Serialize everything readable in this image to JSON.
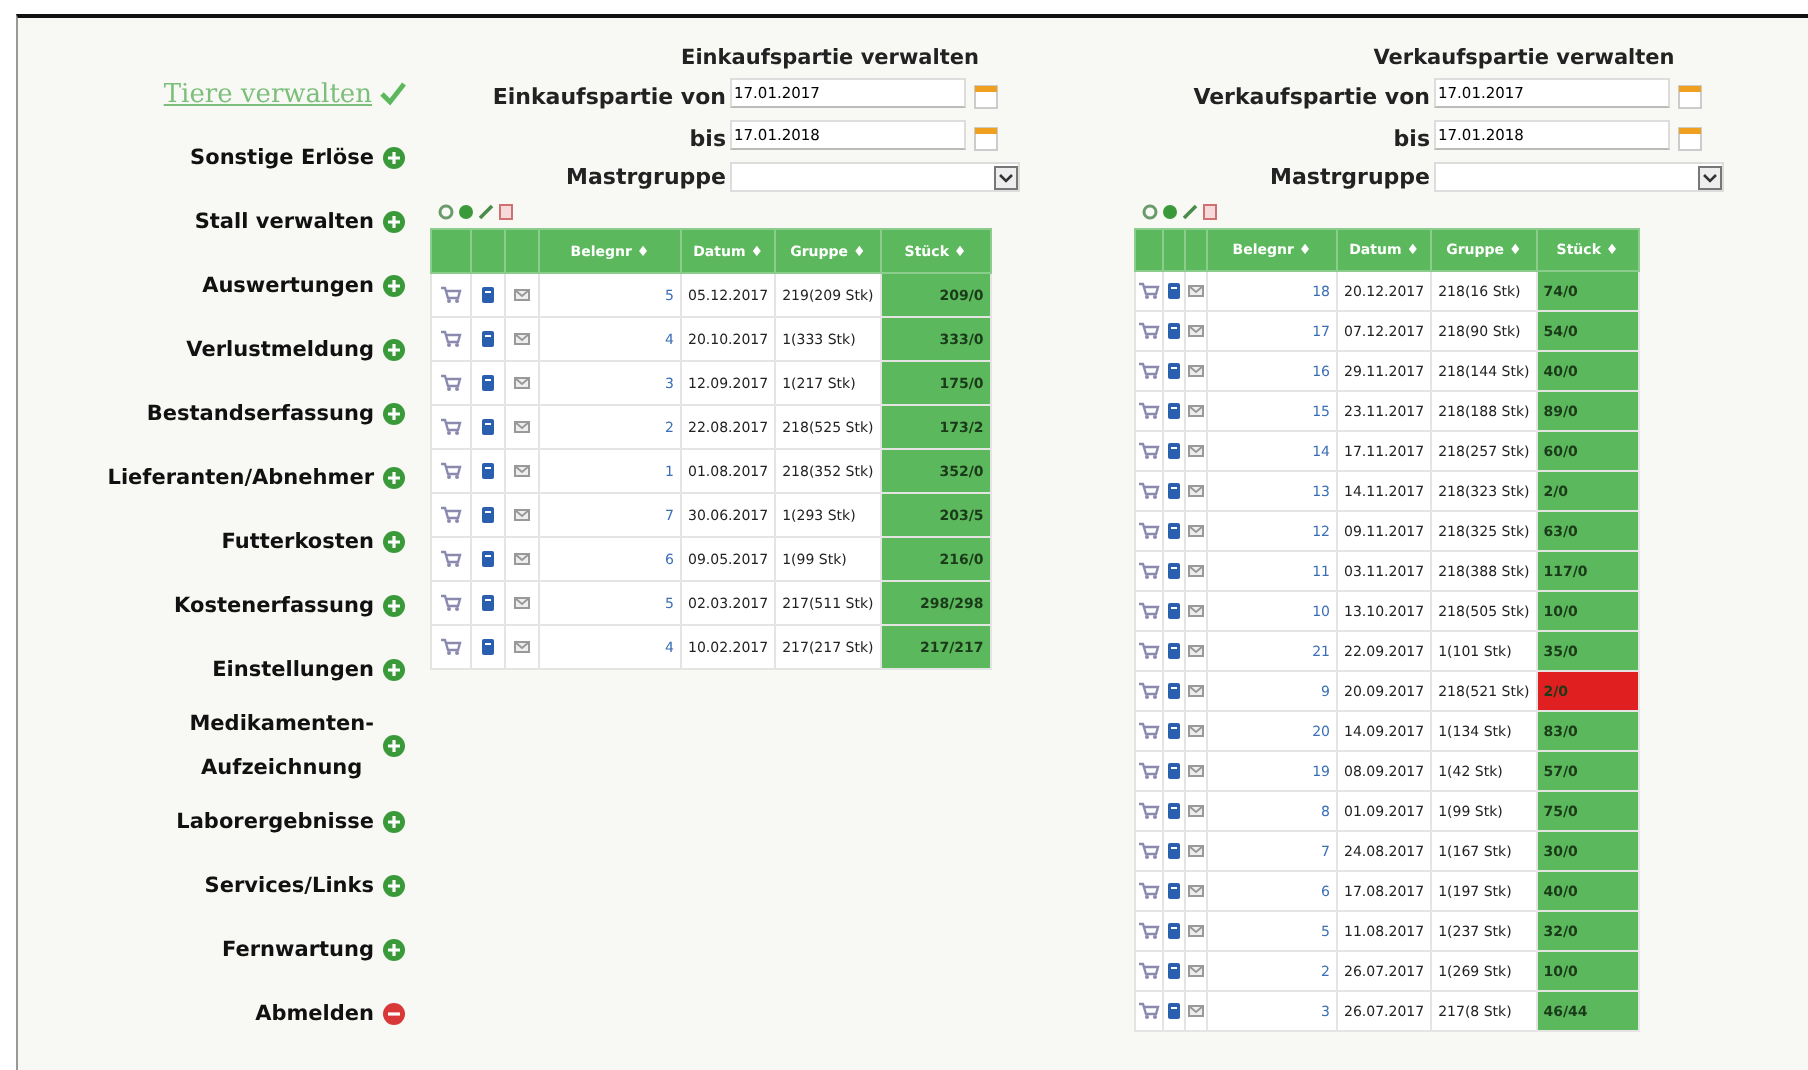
{
  "sidebar": {
    "items": [
      {
        "label": "Tiere verwalten",
        "selected": true,
        "kind": "module"
      },
      {
        "label": "Sonstige Erlöse",
        "selected": false,
        "kind": "module"
      },
      {
        "label": "Stall verwalten",
        "selected": false,
        "kind": "module"
      },
      {
        "label": "Auswertungen",
        "selected": false,
        "kind": "module"
      },
      {
        "label": "Verlustmeldung",
        "selected": false,
        "kind": "module"
      },
      {
        "label": "Bestandserfassung",
        "selected": false,
        "kind": "module"
      },
      {
        "label": "Lieferanten/Abnehmer",
        "selected": false,
        "kind": "module"
      },
      {
        "label": "Futterkosten",
        "selected": false,
        "kind": "module"
      },
      {
        "label": "Kostenerfassung",
        "selected": false,
        "kind": "module"
      },
      {
        "label": "Einstellungen",
        "selected": false,
        "kind": "module"
      },
      {
        "label": "Medikamenten-\nAufzeichnung",
        "selected": false,
        "kind": "module"
      },
      {
        "label": "Laborergebnisse",
        "selected": false,
        "kind": "module"
      },
      {
        "label": "Services/Links",
        "selected": false,
        "kind": "module"
      },
      {
        "label": "Fernwartung",
        "selected": false,
        "kind": "module"
      },
      {
        "label": "Abmelden",
        "selected": false,
        "kind": "logout"
      }
    ]
  },
  "panels": [
    {
      "title": "Einkaufspartie verwalten",
      "from_label": "Einkaufspartie von",
      "from_value": "17.01.2017",
      "to_label": "bis",
      "to_value": "17.01.2018",
      "group_label": "Mastrgruppe",
      "columns": [
        "Belegnr ♦",
        "Datum ♦",
        "Gruppe ♦",
        "Stück ♦"
      ],
      "rows": [
        {
          "belegnr": "5",
          "datum": "05.12.2017",
          "gruppe": "219(209 Stk)",
          "stueck": "209/0",
          "color": "#5cb85c"
        },
        {
          "belegnr": "4",
          "datum": "20.10.2017",
          "gruppe": "1(333 Stk)",
          "stueck": "333/0",
          "color": "#5cb85c"
        },
        {
          "belegnr": "3",
          "datum": "12.09.2017",
          "gruppe": "1(217 Stk)",
          "stueck": "175/0",
          "color": "#5cb85c"
        },
        {
          "belegnr": "2",
          "datum": "22.08.2017",
          "gruppe": "218(525 Stk)",
          "stueck": "173/2",
          "color": "#5cb85c"
        },
        {
          "belegnr": "1",
          "datum": "01.08.2017",
          "gruppe": "218(352 Stk)",
          "stueck": "352/0",
          "color": "#5cb85c"
        },
        {
          "belegnr": "7",
          "datum": "30.06.2017",
          "gruppe": "1(293 Stk)",
          "stueck": "203/5",
          "color": "#5cb85c"
        },
        {
          "belegnr": "6",
          "datum": "09.05.2017",
          "gruppe": "1(99 Stk)",
          "stueck": "216/0",
          "color": "#5cb85c"
        },
        {
          "belegnr": "5",
          "datum": "02.03.2017",
          "gruppe": "217(511 Stk)",
          "stueck": "298/298",
          "color": "#5cb85c"
        },
        {
          "belegnr": "4",
          "datum": "10.02.2017",
          "gruppe": "217(217 Stk)",
          "stueck": "217/217",
          "color": "#5cb85c"
        }
      ]
    },
    {
      "title": "Verkaufspartie verwalten",
      "from_label": "Verkaufspartie von",
      "from_value": "17.01.2017",
      "to_label": "bis",
      "to_value": "17.01.2018",
      "group_label": "Mastrgruppe",
      "columns": [
        "Belegnr ♦",
        "Datum ♦",
        "Gruppe ♦",
        "Stück ♦"
      ],
      "rows": [
        {
          "belegnr": "18",
          "datum": "20.12.2017",
          "gruppe": "218(16 Stk)",
          "stueck": "74/0",
          "color": "#5cb85c"
        },
        {
          "belegnr": "17",
          "datum": "07.12.2017",
          "gruppe": "218(90 Stk)",
          "stueck": "54/0",
          "color": "#5cb85c"
        },
        {
          "belegnr": "16",
          "datum": "29.11.2017",
          "gruppe": "218(144 Stk)",
          "stueck": "40/0",
          "color": "#5cb85c"
        },
        {
          "belegnr": "15",
          "datum": "23.11.2017",
          "gruppe": "218(188 Stk)",
          "stueck": "89/0",
          "color": "#5cb85c"
        },
        {
          "belegnr": "14",
          "datum": "17.11.2017",
          "gruppe": "218(257 Stk)",
          "stueck": "60/0",
          "color": "#5cb85c"
        },
        {
          "belegnr": "13",
          "datum": "14.11.2017",
          "gruppe": "218(323 Stk)",
          "stueck": "2/0",
          "color": "#5cb85c"
        },
        {
          "belegnr": "12",
          "datum": "09.11.2017",
          "gruppe": "218(325 Stk)",
          "stueck": "63/0",
          "color": "#5cb85c"
        },
        {
          "belegnr": "11",
          "datum": "03.11.2017",
          "gruppe": "218(388 Stk)",
          "stueck": "117/0",
          "color": "#5cb85c"
        },
        {
          "belegnr": "10",
          "datum": "13.10.2017",
          "gruppe": "218(505 Stk)",
          "stueck": "10/0",
          "color": "#5cb85c"
        },
        {
          "belegnr": "21",
          "datum": "22.09.2017",
          "gruppe": "1(101 Stk)",
          "stueck": "35/0",
          "color": "#5cb85c"
        },
        {
          "belegnr": "9",
          "datum": "20.09.2017",
          "gruppe": "218(521 Stk)",
          "stueck": "2/0",
          "color": "#e02020"
        },
        {
          "belegnr": "20",
          "datum": "14.09.2017",
          "gruppe": "1(134 Stk)",
          "stueck": "83/0",
          "color": "#5cb85c"
        },
        {
          "belegnr": "19",
          "datum": "08.09.2017",
          "gruppe": "1(42 Stk)",
          "stueck": "57/0",
          "color": "#5cb85c"
        },
        {
          "belegnr": "8",
          "datum": "01.09.2017",
          "gruppe": "1(99 Stk)",
          "stueck": "75/0",
          "color": "#5cb85c"
        },
        {
          "belegnr": "7",
          "datum": "24.08.2017",
          "gruppe": "1(167 Stk)",
          "stueck": "30/0",
          "color": "#5cb85c"
        },
        {
          "belegnr": "6",
          "datum": "17.08.2017",
          "gruppe": "1(197 Stk)",
          "stueck": "40/0",
          "color": "#5cb85c"
        },
        {
          "belegnr": "5",
          "datum": "11.08.2017",
          "gruppe": "1(237 Stk)",
          "stueck": "32/0",
          "color": "#5cb85c"
        },
        {
          "belegnr": "2",
          "datum": "26.07.2017",
          "gruppe": "1(269 Stk)",
          "stueck": "10/0",
          "color": "#5cb85c"
        },
        {
          "belegnr": "3",
          "datum": "26.07.2017",
          "gruppe": "217(8 Stk)",
          "stueck": "46/44",
          "color": "#5cb85c"
        }
      ]
    }
  ]
}
